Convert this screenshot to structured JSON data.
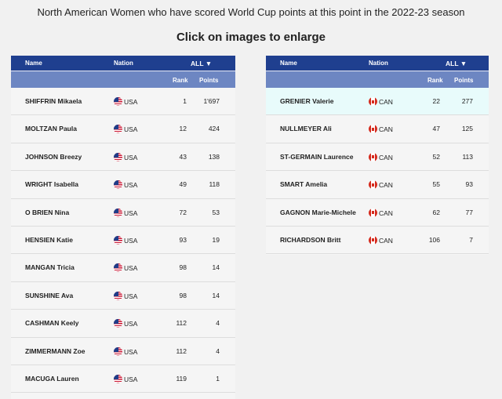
{
  "header": {
    "title": "North American Women who have scored World Cup points at this point in the 2022-23 season",
    "subtitle": "Click on images to enlarge"
  },
  "columns": {
    "name": "Name",
    "nation": "Nation",
    "filter": "ALL ▼",
    "rank": "Rank",
    "points": "Points"
  },
  "usa_table": {
    "rows": [
      {
        "name": "SHIFFRIN Mikaela",
        "nation": "USA",
        "rank": "1",
        "points": "1'697"
      },
      {
        "name": "MOLTZAN Paula",
        "nation": "USA",
        "rank": "12",
        "points": "424"
      },
      {
        "name": "JOHNSON Breezy",
        "nation": "USA",
        "rank": "43",
        "points": "138"
      },
      {
        "name": "WRIGHT Isabella",
        "nation": "USA",
        "rank": "49",
        "points": "118"
      },
      {
        "name": "O BRIEN Nina",
        "nation": "USA",
        "rank": "72",
        "points": "53"
      },
      {
        "name": "HENSIEN Katie",
        "nation": "USA",
        "rank": "93",
        "points": "19"
      },
      {
        "name": "MANGAN Tricia",
        "nation": "USA",
        "rank": "98",
        "points": "14"
      },
      {
        "name": "SUNSHINE Ava",
        "nation": "USA",
        "rank": "98",
        "points": "14"
      },
      {
        "name": "CASHMAN Keely",
        "nation": "USA",
        "rank": "112",
        "points": "4"
      },
      {
        "name": "ZIMMERMANN Zoe",
        "nation": "USA",
        "rank": "112",
        "points": "4"
      },
      {
        "name": "MACUGA Lauren",
        "nation": "USA",
        "rank": "119",
        "points": "1"
      }
    ]
  },
  "can_table": {
    "rows": [
      {
        "name": "GRENIER Valerie",
        "nation": "CAN",
        "rank": "22",
        "points": "277"
      },
      {
        "name": "NULLMEYER Ali",
        "nation": "CAN",
        "rank": "47",
        "points": "125"
      },
      {
        "name": "ST-GERMAIN Laurence",
        "nation": "CAN",
        "rank": "52",
        "points": "113"
      },
      {
        "name": "SMART Amelia",
        "nation": "CAN",
        "rank": "55",
        "points": "93"
      },
      {
        "name": "GAGNON Marie-Michele",
        "nation": "CAN",
        "rank": "62",
        "points": "77"
      },
      {
        "name": "RICHARDSON Britt",
        "nation": "CAN",
        "rank": "106",
        "points": "7"
      }
    ]
  },
  "colors": {
    "header_dark": "#1f3f8f",
    "header_light": "#6d86c2",
    "highlight_row": "#e8fbfb"
  }
}
